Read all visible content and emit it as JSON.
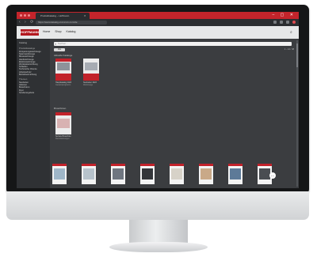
{
  "browser": {
    "tab_title": "Produktkatalog – Hoffmann",
    "url": "https://www.katalog-xxxxxxxx.com/de",
    "window_controls": "– ▢ ✕",
    "tab_close": "×",
    "nav_glyphs": "‹ › ⟳"
  },
  "site": {
    "logo": "HOFFMANN",
    "nav": [
      "Home",
      "Shop",
      "Katalog"
    ],
    "search_placeholder": "Suchen…",
    "filter_chip": "Alle",
    "result_count": "1 – 12 / 48"
  },
  "sidebar": {
    "heading": "Katalog",
    "groups": [
      {
        "title": "Produktkataloge",
        "items": [
          "Zerspanungswerkzeuge",
          "Spannwerkzeuge",
          "Messwerkzeuge",
          "Handwerkzeuge",
          "Elektrowerkzeuge",
          "Werkstatteinrichtung",
          "Schleifen",
          "Technische Chemie",
          "Arbeitsschutz",
          "Betriebseinrichtung"
        ]
      },
      {
        "title": "Themen",
        "items": [
          "Neuheiten",
          "Aktionen",
          "Broschüren",
          "Flyer",
          "Sonderangebote"
        ]
      }
    ]
  },
  "sections": [
    {
      "label": "Aktuelle Kataloge",
      "products": [
        {
          "title": "Hauptkatalog 2023",
          "subtitle": "Gesamtprogramm"
        },
        {
          "title": "Neuheiten 2023",
          "subtitle": "Werkzeuge"
        }
      ]
    },
    {
      "label": "Broschüren",
      "products": [
        {
          "title": "Service Broschüre",
          "subtitle": "Dienstleistungen"
        }
      ]
    }
  ],
  "catalog_row": [
    {
      "name": "catalog-1",
      "color": "#9fb6c8"
    },
    {
      "name": "catalog-2",
      "color": "#b7c3cc"
    },
    {
      "name": "catalog-3",
      "color": "#6f7680"
    },
    {
      "name": "catalog-4",
      "color": "#34363a"
    },
    {
      "name": "catalog-5",
      "color": "#d7d2c8"
    },
    {
      "name": "catalog-6",
      "color": "#c9a988"
    },
    {
      "name": "catalog-7",
      "color": "#5d7a98"
    },
    {
      "name": "catalog-8",
      "color": "#4a4d52"
    },
    {
      "name": "catalog-9",
      "color": "#c5d3de"
    }
  ],
  "chat_icon": "…",
  "colors": {
    "accent": "#c3242b",
    "screen_bg": "#3b3d40"
  }
}
